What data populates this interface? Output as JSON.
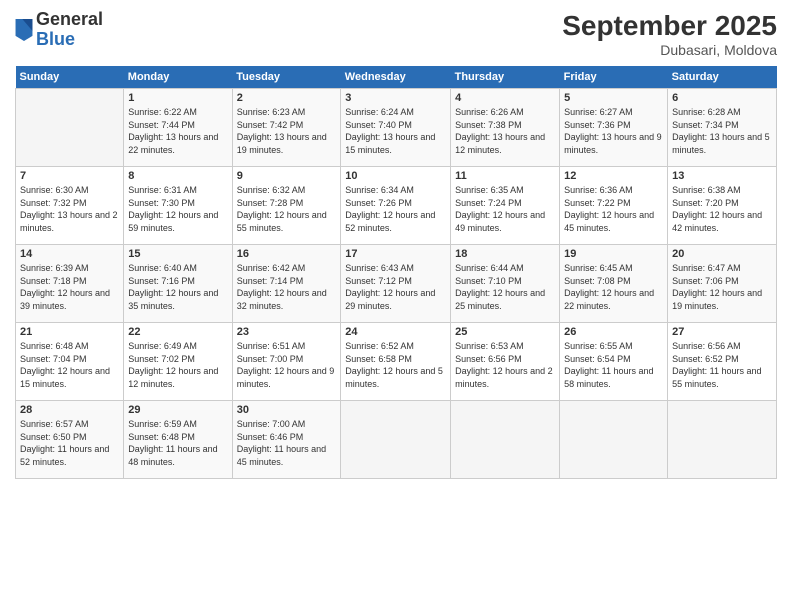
{
  "logo": {
    "general": "General",
    "blue": "Blue"
  },
  "title": "September 2025",
  "subtitle": "Dubasari, Moldova",
  "days_header": [
    "Sunday",
    "Monday",
    "Tuesday",
    "Wednesday",
    "Thursday",
    "Friday",
    "Saturday"
  ],
  "weeks": [
    [
      {
        "day": "",
        "info": ""
      },
      {
        "day": "1",
        "info": "Sunrise: 6:22 AM\nSunset: 7:44 PM\nDaylight: 13 hours and 22 minutes."
      },
      {
        "day": "2",
        "info": "Sunrise: 6:23 AM\nSunset: 7:42 PM\nDaylight: 13 hours and 19 minutes."
      },
      {
        "day": "3",
        "info": "Sunrise: 6:24 AM\nSunset: 7:40 PM\nDaylight: 13 hours and 15 minutes."
      },
      {
        "day": "4",
        "info": "Sunrise: 6:26 AM\nSunset: 7:38 PM\nDaylight: 13 hours and 12 minutes."
      },
      {
        "day": "5",
        "info": "Sunrise: 6:27 AM\nSunset: 7:36 PM\nDaylight: 13 hours and 9 minutes."
      },
      {
        "day": "6",
        "info": "Sunrise: 6:28 AM\nSunset: 7:34 PM\nDaylight: 13 hours and 5 minutes."
      }
    ],
    [
      {
        "day": "7",
        "info": "Sunrise: 6:30 AM\nSunset: 7:32 PM\nDaylight: 13 hours and 2 minutes."
      },
      {
        "day": "8",
        "info": "Sunrise: 6:31 AM\nSunset: 7:30 PM\nDaylight: 12 hours and 59 minutes."
      },
      {
        "day": "9",
        "info": "Sunrise: 6:32 AM\nSunset: 7:28 PM\nDaylight: 12 hours and 55 minutes."
      },
      {
        "day": "10",
        "info": "Sunrise: 6:34 AM\nSunset: 7:26 PM\nDaylight: 12 hours and 52 minutes."
      },
      {
        "day": "11",
        "info": "Sunrise: 6:35 AM\nSunset: 7:24 PM\nDaylight: 12 hours and 49 minutes."
      },
      {
        "day": "12",
        "info": "Sunrise: 6:36 AM\nSunset: 7:22 PM\nDaylight: 12 hours and 45 minutes."
      },
      {
        "day": "13",
        "info": "Sunrise: 6:38 AM\nSunset: 7:20 PM\nDaylight: 12 hours and 42 minutes."
      }
    ],
    [
      {
        "day": "14",
        "info": "Sunrise: 6:39 AM\nSunset: 7:18 PM\nDaylight: 12 hours and 39 minutes."
      },
      {
        "day": "15",
        "info": "Sunrise: 6:40 AM\nSunset: 7:16 PM\nDaylight: 12 hours and 35 minutes."
      },
      {
        "day": "16",
        "info": "Sunrise: 6:42 AM\nSunset: 7:14 PM\nDaylight: 12 hours and 32 minutes."
      },
      {
        "day": "17",
        "info": "Sunrise: 6:43 AM\nSunset: 7:12 PM\nDaylight: 12 hours and 29 minutes."
      },
      {
        "day": "18",
        "info": "Sunrise: 6:44 AM\nSunset: 7:10 PM\nDaylight: 12 hours and 25 minutes."
      },
      {
        "day": "19",
        "info": "Sunrise: 6:45 AM\nSunset: 7:08 PM\nDaylight: 12 hours and 22 minutes."
      },
      {
        "day": "20",
        "info": "Sunrise: 6:47 AM\nSunset: 7:06 PM\nDaylight: 12 hours and 19 minutes."
      }
    ],
    [
      {
        "day": "21",
        "info": "Sunrise: 6:48 AM\nSunset: 7:04 PM\nDaylight: 12 hours and 15 minutes."
      },
      {
        "day": "22",
        "info": "Sunrise: 6:49 AM\nSunset: 7:02 PM\nDaylight: 12 hours and 12 minutes."
      },
      {
        "day": "23",
        "info": "Sunrise: 6:51 AM\nSunset: 7:00 PM\nDaylight: 12 hours and 9 minutes."
      },
      {
        "day": "24",
        "info": "Sunrise: 6:52 AM\nSunset: 6:58 PM\nDaylight: 12 hours and 5 minutes."
      },
      {
        "day": "25",
        "info": "Sunrise: 6:53 AM\nSunset: 6:56 PM\nDaylight: 12 hours and 2 minutes."
      },
      {
        "day": "26",
        "info": "Sunrise: 6:55 AM\nSunset: 6:54 PM\nDaylight: 11 hours and 58 minutes."
      },
      {
        "day": "27",
        "info": "Sunrise: 6:56 AM\nSunset: 6:52 PM\nDaylight: 11 hours and 55 minutes."
      }
    ],
    [
      {
        "day": "28",
        "info": "Sunrise: 6:57 AM\nSunset: 6:50 PM\nDaylight: 11 hours and 52 minutes."
      },
      {
        "day": "29",
        "info": "Sunrise: 6:59 AM\nSunset: 6:48 PM\nDaylight: 11 hours and 48 minutes."
      },
      {
        "day": "30",
        "info": "Sunrise: 7:00 AM\nSunset: 6:46 PM\nDaylight: 11 hours and 45 minutes."
      },
      {
        "day": "",
        "info": ""
      },
      {
        "day": "",
        "info": ""
      },
      {
        "day": "",
        "info": ""
      },
      {
        "day": "",
        "info": ""
      }
    ]
  ]
}
